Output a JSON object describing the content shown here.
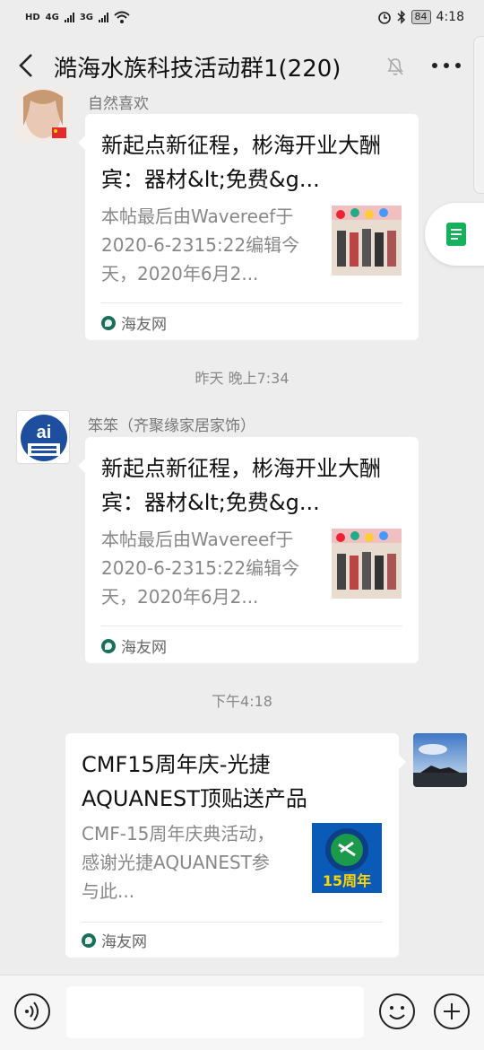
{
  "status_bar": {
    "left_label": "HD",
    "net1": "4G",
    "net2": "3G",
    "battery": "84",
    "time": "4:18"
  },
  "header": {
    "title": "澔海水族科技活动群1(220)"
  },
  "messages": [
    {
      "sender": "自然喜欢",
      "title": "新起点新征程，彬海开业大酬宾：器材&lt;免费&g...",
      "desc": "本帖最后由Wavereef于2020-6-2315:22编辑今天，2020年6月2...",
      "source": "海友网"
    },
    {
      "sender": "笨笨（齐聚缘家居家饰）",
      "title": "新起点新征程，彬海开业大酬宾：器材&lt;免费&g...",
      "desc": "本帖最后由Wavereef于2020-6-2315:22编辑今天，2020年6月2...",
      "source": "海友网"
    },
    {
      "sender": "",
      "title": "CMF15周年庆-光捷AQUANEST顶贴送产品",
      "desc": "CMF-15周年庆典活动，感谢光捷AQUANEST参与此...",
      "source": "海友网",
      "thumb_text": "15周年"
    }
  ],
  "timestamps": {
    "t1": "昨天 晚上7:34",
    "t2": "下午4:18"
  },
  "colors": {
    "background": "#ededed",
    "card": "#ffffff",
    "accent_green": "#15b15b"
  },
  "icons": {
    "back": "back-arrow-icon",
    "mute": "mute-bell-icon",
    "more": "more-dots-icon",
    "voice": "voice-icon",
    "emoji": "emoji-icon",
    "plus": "plus-icon"
  }
}
